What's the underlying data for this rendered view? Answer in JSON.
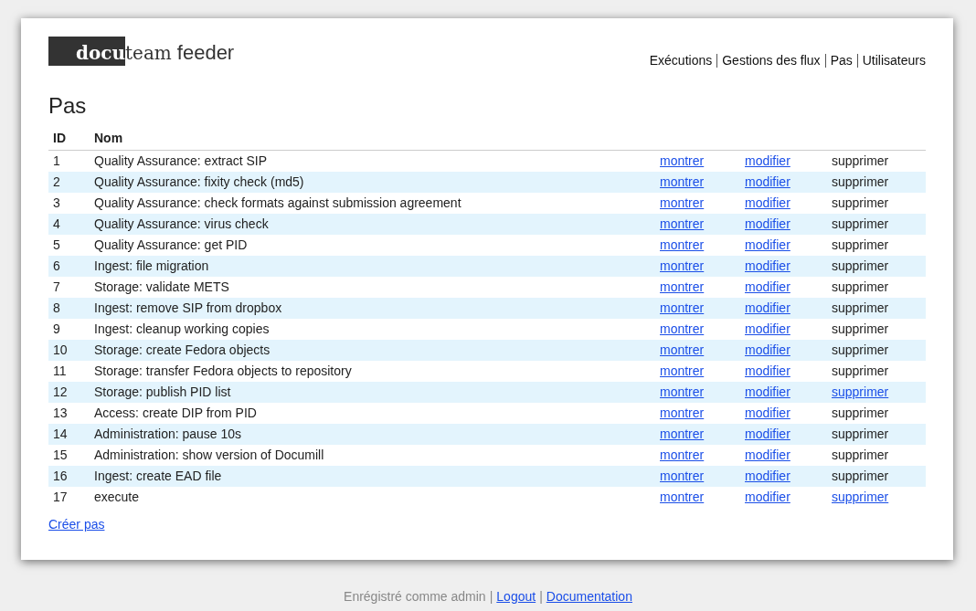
{
  "logo": {
    "part_1": "docu",
    "part_2": "team",
    "part_3": "feeder"
  },
  "nav": [
    {
      "label": "Exécutions"
    },
    {
      "label": "Gestions des flux"
    },
    {
      "label": "Pas"
    },
    {
      "label": "Utilisateurs"
    }
  ],
  "heading": "Pas",
  "table": {
    "columns": [
      "ID",
      "Nom"
    ],
    "rows": [
      {
        "id": "1",
        "name": "Quality Assurance: extract SIP",
        "show": "montrer",
        "edit": "modifier",
        "delete": "supprimer",
        "delete_link": false
      },
      {
        "id": "2",
        "name": "Quality Assurance: fixity check (md5)",
        "show": "montrer",
        "edit": "modifier",
        "delete": "supprimer",
        "delete_link": false
      },
      {
        "id": "3",
        "name": "Quality Assurance: check formats against submission agreement",
        "show": "montrer",
        "edit": "modifier",
        "delete": "supprimer",
        "delete_link": false
      },
      {
        "id": "4",
        "name": "Quality Assurance: virus check",
        "show": "montrer",
        "edit": "modifier",
        "delete": "supprimer",
        "delete_link": false
      },
      {
        "id": "5",
        "name": "Quality Assurance: get PID",
        "show": "montrer",
        "edit": "modifier",
        "delete": "supprimer",
        "delete_link": false
      },
      {
        "id": "6",
        "name": "Ingest: file migration",
        "show": "montrer",
        "edit": "modifier",
        "delete": "supprimer",
        "delete_link": false
      },
      {
        "id": "7",
        "name": "Storage: validate METS",
        "show": "montrer",
        "edit": "modifier",
        "delete": "supprimer",
        "delete_link": false
      },
      {
        "id": "8",
        "name": "Ingest: remove SIP from dropbox",
        "show": "montrer",
        "edit": "modifier",
        "delete": "supprimer",
        "delete_link": false
      },
      {
        "id": "9",
        "name": "Ingest: cleanup working copies",
        "show": "montrer",
        "edit": "modifier",
        "delete": "supprimer",
        "delete_link": false
      },
      {
        "id": "10",
        "name": "Storage: create Fedora objects",
        "show": "montrer",
        "edit": "modifier",
        "delete": "supprimer",
        "delete_link": false
      },
      {
        "id": "11",
        "name": "Storage: transfer Fedora objects to repository",
        "show": "montrer",
        "edit": "modifier",
        "delete": "supprimer",
        "delete_link": false
      },
      {
        "id": "12",
        "name": "Storage: publish PID list",
        "show": "montrer",
        "edit": "modifier",
        "delete": "supprimer",
        "delete_link": true
      },
      {
        "id": "13",
        "name": "Access: create DIP from PID",
        "show": "montrer",
        "edit": "modifier",
        "delete": "supprimer",
        "delete_link": false
      },
      {
        "id": "14",
        "name": "Administration: pause 10s",
        "show": "montrer",
        "edit": "modifier",
        "delete": "supprimer",
        "delete_link": false
      },
      {
        "id": "15",
        "name": "Administration: show version of Documill",
        "show": "montrer",
        "edit": "modifier",
        "delete": "supprimer",
        "delete_link": false
      },
      {
        "id": "16",
        "name": "Ingest: create EAD file",
        "show": "montrer",
        "edit": "modifier",
        "delete": "supprimer",
        "delete_link": false
      },
      {
        "id": "17",
        "name": "execute",
        "show": "montrer",
        "edit": "modifier",
        "delete": "supprimer",
        "delete_link": true
      }
    ]
  },
  "create_link": "Créer pas",
  "footer": {
    "status": "Enrégistré comme admin",
    "separator_1": "|",
    "logout": "Logout",
    "separator_2": "|",
    "documentation": "Documentation"
  }
}
